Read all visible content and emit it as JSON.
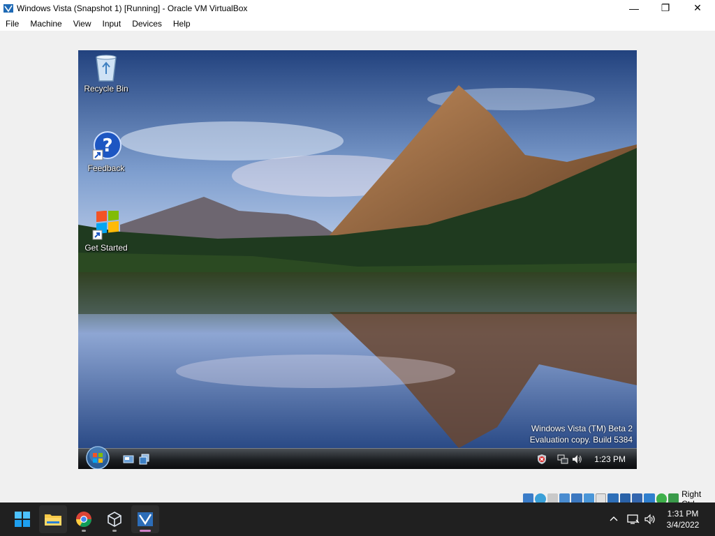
{
  "window": {
    "title": "Windows Vista (Snapshot 1) [Running] - Oracle VM VirtualBox",
    "controls": {
      "minimize": "—",
      "restore": "❐",
      "close": "✕"
    }
  },
  "menu": {
    "items": [
      "File",
      "Machine",
      "View",
      "Input",
      "Devices",
      "Help"
    ]
  },
  "guest": {
    "desktop_icons": [
      {
        "label": "Recycle Bin",
        "icon": "recycle-bin-icon"
      },
      {
        "label": "Feedback",
        "icon": "feedback-help-icon"
      },
      {
        "label": "Get Started",
        "icon": "windows-logo-icon"
      }
    ],
    "watermark": {
      "line1": "Windows Vista (TM) Beta 2",
      "line2": "Evaluation copy. Build 5384"
    },
    "taskbar": {
      "clock": "1:23 PM",
      "quick_launch": [
        "show-desktop-icon",
        "switch-windows-icon"
      ],
      "tray": [
        "security-alert-icon",
        "network-icon",
        "volume-icon"
      ]
    }
  },
  "vbox_status": {
    "host_key": "Right Ctrl",
    "icons": [
      "hard-disk-icon",
      "optical-drive-icon",
      "floppy-icon",
      "audio-icon",
      "network-adapter-icon",
      "usb-icon",
      "shared-folders-icon",
      "display-icon",
      "video-capture-icon",
      "recording-icon",
      "cpu-icon",
      "mouse-integration-icon",
      "keyboard-icon"
    ]
  },
  "host_taskbar": {
    "clock_time": "1:31 PM",
    "clock_date": "3/4/2022",
    "apps": [
      "start-icon",
      "file-explorer-icon",
      "chrome-icon",
      "virtualbox-manager-icon",
      "vista-vm-icon"
    ]
  },
  "colors": {
    "host_taskbar": "#202020",
    "vbox_background": "#f0f0f0",
    "vista_taskbar": "#1c1f22",
    "win11_blue": "#0078d4"
  }
}
